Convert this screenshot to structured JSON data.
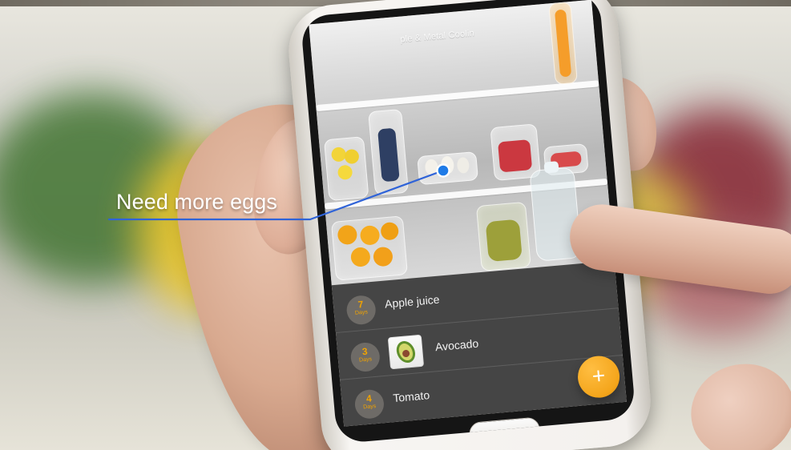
{
  "scene": {
    "note": "Need more eggs",
    "camera": {
      "title": "ple & Metal Coolin"
    },
    "items": [
      {
        "days": "7",
        "days_label": "Days",
        "name": "Apple juice"
      },
      {
        "days": "3",
        "days_label": "Days",
        "name": "Avocado"
      },
      {
        "days": "4",
        "days_label": "Days",
        "name": "Tomato"
      }
    ],
    "fab_symbol": "+"
  }
}
